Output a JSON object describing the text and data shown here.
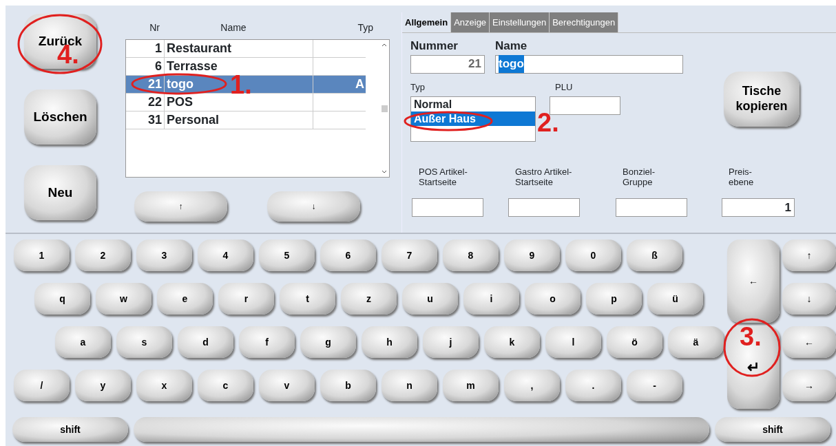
{
  "side_buttons": [
    "Zurück",
    "Löschen",
    "Neu"
  ],
  "table": {
    "columns": [
      "Nr",
      "Name",
      "Typ"
    ],
    "rows": [
      {
        "nr": "1",
        "name": "Restaurant",
        "selected": false
      },
      {
        "nr": "6",
        "name": "Terrasse",
        "selected": false
      },
      {
        "nr": "21",
        "name": "togo",
        "typ": "A",
        "selected": true
      },
      {
        "nr": "22",
        "name": "POS",
        "selected": false
      },
      {
        "nr": "31",
        "name": "Personal",
        "selected": false
      }
    ]
  },
  "list_buttons": [
    "↑",
    "↓"
  ],
  "tabs": [
    {
      "label": "Allgemein",
      "selected": true
    },
    {
      "label": "Anzeige",
      "selected": false
    },
    {
      "label": "Einstellungen",
      "selected": false
    },
    {
      "label": "Berechtigungen",
      "selected": false
    }
  ],
  "nummer": {
    "label": "Nummer",
    "value": "21"
  },
  "name": {
    "label": "Name",
    "value": "togo",
    "text_selected": true
  },
  "copy_button": "Tische\nkopieren",
  "typ": {
    "label": "Typ",
    "options": [
      {
        "label": "Normal",
        "selected": false
      },
      {
        "label": "Außer Haus",
        "selected": true
      }
    ]
  },
  "plu": {
    "label": "PLU"
  },
  "bottom_fields": [
    {
      "label": "POS Artikel-\nStartseite"
    },
    {
      "label": "Gastro Artikel-\nStartseite"
    },
    {
      "label": "Bonziel-\nGruppe"
    },
    {
      "label": "Preis-\nebene",
      "value": "1"
    }
  ],
  "keyboard": {
    "rows": [
      [
        "1",
        "2",
        "3",
        "4",
        "5",
        "6",
        "7",
        "8",
        "9",
        "0",
        "ß"
      ],
      [
        "q",
        "w",
        "e",
        "r",
        "t",
        "z",
        "u",
        "i",
        "o",
        "p",
        "ü"
      ],
      [
        "a",
        "s",
        "d",
        "f",
        "g",
        "h",
        "j",
        "k",
        "l",
        "ö",
        "ä"
      ],
      [
        "/",
        "y",
        "x",
        "c",
        "v",
        "b",
        "n",
        "m",
        ",",
        ".",
        "-"
      ]
    ],
    "backspace": "←",
    "enter": "↵",
    "arrows": [
      "↑",
      "↓",
      "←",
      "→"
    ],
    "bottom_row": [
      {
        "kind": "shift",
        "label": "shift"
      },
      {
        "kind": "space"
      },
      {
        "kind": "shift",
        "label": "shift"
      }
    ]
  },
  "annotations": [
    {
      "label": "4."
    },
    {
      "label": "1."
    },
    {
      "label": "2."
    },
    {
      "label": "3."
    }
  ]
}
